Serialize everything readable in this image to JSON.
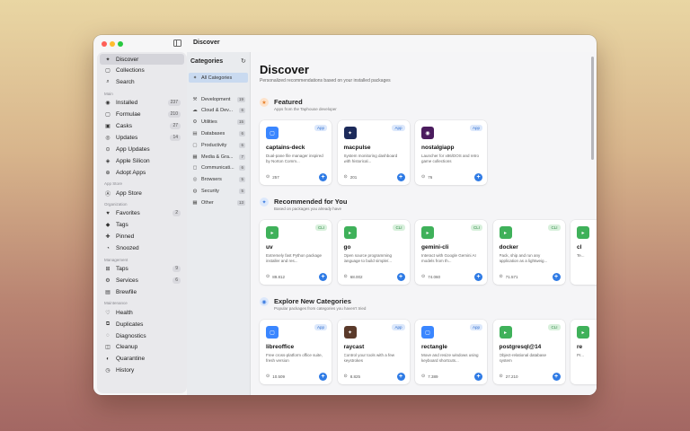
{
  "window": {
    "title": "Discover"
  },
  "sidebar": {
    "items_top": [
      {
        "icon": "sparkles-icon",
        "glyph": "✦",
        "label": "Discover",
        "active": true
      },
      {
        "icon": "collections-icon",
        "glyph": "▢",
        "label": "Collections"
      },
      {
        "icon": "search-icon",
        "glyph": "⌕",
        "label": "Search"
      }
    ],
    "section_main": "Main",
    "items_main": [
      {
        "icon": "check-circle-icon",
        "glyph": "◉",
        "label": "Installed",
        "count": "237"
      },
      {
        "icon": "box-icon",
        "glyph": "▢",
        "label": "Formulae",
        "count": "210"
      },
      {
        "icon": "cask-icon",
        "glyph": "▣",
        "label": "Casks",
        "count": "27"
      },
      {
        "icon": "arrow-up-circle-icon",
        "glyph": "◎",
        "label": "Updates",
        "count": "14"
      },
      {
        "icon": "app-updates-icon",
        "glyph": "⊙",
        "label": "App Updates"
      },
      {
        "icon": "cpu-icon",
        "glyph": "◈",
        "label": "Apple Silicon"
      },
      {
        "icon": "adopt-icon",
        "glyph": "⊕",
        "label": "Adopt Apps"
      }
    ],
    "section_appstore": "App Store",
    "items_appstore": [
      {
        "icon": "app-store-icon",
        "glyph": "Ⓐ",
        "label": "App Store"
      }
    ],
    "section_org": "Organization",
    "items_org": [
      {
        "icon": "heart-icon",
        "glyph": "♥",
        "label": "Favorites",
        "count": "2"
      },
      {
        "icon": "tag-icon",
        "glyph": "◆",
        "label": "Tags"
      },
      {
        "icon": "pin-icon",
        "glyph": "✚",
        "label": "Pinned"
      },
      {
        "icon": "snooze-icon",
        "glyph": "◔",
        "label": "Snoozed"
      }
    ],
    "section_mgmt": "Management",
    "items_mgmt": [
      {
        "icon": "taps-icon",
        "glyph": "⊞",
        "label": "Taps",
        "count": "9"
      },
      {
        "icon": "services-icon",
        "glyph": "⚙",
        "label": "Services",
        "count": "6"
      },
      {
        "icon": "brewfile-icon",
        "glyph": "▤",
        "label": "Brewfile"
      }
    ],
    "section_maint": "Maintenance",
    "items_maint": [
      {
        "icon": "health-icon",
        "glyph": "♡",
        "label": "Health"
      },
      {
        "icon": "duplicates-icon",
        "glyph": "⧉",
        "label": "Duplicates"
      },
      {
        "icon": "diagnostics-icon",
        "glyph": "◌",
        "label": "Diagnostics"
      },
      {
        "icon": "cleanup-icon",
        "glyph": "◫",
        "label": "Cleanup"
      },
      {
        "icon": "quarantine-icon",
        "glyph": "◐",
        "label": "Quarantine"
      },
      {
        "icon": "history-icon",
        "glyph": "◷",
        "label": "History"
      }
    ]
  },
  "categories": {
    "title": "Categories",
    "items": [
      {
        "icon": "sparkles-icon",
        "glyph": "✦",
        "label": "All Categories",
        "active": true
      },
      {
        "icon": "hammer-icon",
        "glyph": "⚒",
        "label": "Development",
        "count": "19"
      },
      {
        "icon": "cloud-icon",
        "glyph": "☁",
        "label": "Cloud & Dev...",
        "count": "6"
      },
      {
        "icon": "wrench-icon",
        "glyph": "⚙",
        "label": "Utilities",
        "count": "15"
      },
      {
        "icon": "database-icon",
        "glyph": "▤",
        "label": "Databases",
        "count": "6"
      },
      {
        "icon": "productivity-icon",
        "glyph": "▢",
        "label": "Productivity",
        "count": "6"
      },
      {
        "icon": "media-icon",
        "glyph": "▦",
        "label": "Media & Gra...",
        "count": "7"
      },
      {
        "icon": "communication-icon",
        "glyph": "◻",
        "label": "Communicati...",
        "count": "6"
      },
      {
        "icon": "globe-icon",
        "glyph": "◎",
        "label": "Browsers",
        "count": "5"
      },
      {
        "icon": "lock-icon",
        "glyph": "◍",
        "label": "Security",
        "count": "5"
      },
      {
        "icon": "grid-icon",
        "glyph": "▦",
        "label": "Other",
        "count": "13"
      }
    ]
  },
  "main": {
    "title": "Discover",
    "subtitle": "Personalized recommendations based on your installed packages",
    "sections": [
      {
        "icon": "star-icon",
        "glyph": "★",
        "icon_bg": "#fde3cc",
        "icon_color": "#e8812c",
        "title": "Featured",
        "subtitle": "Apps from the Taphouse developer",
        "cards": [
          {
            "name": "captains-deck",
            "desc": "Dual-pane file manager inspired by Norton Comm...",
            "downloads": "257",
            "badge": "App",
            "icon_bg": "#3a86ff",
            "glyph": "▢"
          },
          {
            "name": "macpulse",
            "desc": "System monitoring dashboard with historical...",
            "downloads": "201",
            "badge": "App",
            "icon_bg": "#1c2a5a",
            "glyph": "✦"
          },
          {
            "name": "nostalgiapp",
            "desc": "Launcher for x86/DOS and retro game collections",
            "downloads": "76",
            "badge": "App",
            "icon_bg": "#4b1c5e",
            "glyph": "◉"
          }
        ]
      },
      {
        "icon": "sparkle-icon",
        "glyph": "✦",
        "icon_bg": "#dce8fb",
        "icon_color": "#3a7be0",
        "title": "Recommended for You",
        "subtitle": "Based on packages you already have",
        "cards": [
          {
            "name": "uv",
            "desc": "Extremely fast Python package installer and res...",
            "downloads": "89.812",
            "badge": "CLI",
            "icon_bg": "#3fb15a",
            "glyph": "▸"
          },
          {
            "name": "go",
            "desc": "Open source programming language to build simple/...",
            "downloads": "68.002",
            "badge": "CLI",
            "icon_bg": "#3fb15a",
            "glyph": "▸"
          },
          {
            "name": "gemini-cli",
            "desc": "Interact with Google Gemini AI models from th...",
            "downloads": "74.060",
            "badge": "CLI",
            "icon_bg": "#3fb15a",
            "glyph": "▸"
          },
          {
            "name": "docker",
            "desc": "Pack, ship and run any application as a lightweig...",
            "downloads": "71.571",
            "badge": "CLI",
            "icon_bg": "#3fb15a",
            "glyph": "▸"
          },
          {
            "name": "cl",
            "desc": "Te...",
            "downloads": "",
            "badge": "",
            "icon_bg": "#3fb15a",
            "glyph": "▸"
          }
        ]
      },
      {
        "icon": "lightbulb-icon",
        "glyph": "◉",
        "icon_bg": "#dce8fb",
        "icon_color": "#3a7be0",
        "title": "Explore New Categories",
        "subtitle": "Popular packages from categories you haven't tried",
        "cards": [
          {
            "name": "libreoffice",
            "desc": "Free cross-platform office suite, fresh version",
            "downloads": "10.509",
            "badge": "App",
            "icon_bg": "#3a86ff",
            "glyph": "▢"
          },
          {
            "name": "raycast",
            "desc": "Control your tools with a few keystrokes",
            "downloads": "8.825",
            "badge": "App",
            "icon_bg": "#5a3a2a",
            "glyph": "✦"
          },
          {
            "name": "rectangle",
            "desc": "Move and resize windows using keyboard shortcuts...",
            "downloads": "7.389",
            "badge": "App",
            "icon_bg": "#3a86ff",
            "glyph": "▢"
          },
          {
            "name": "postgresql@14",
            "desc": "Object-relational database system",
            "downloads": "27.210",
            "badge": "CLI",
            "icon_bg": "#3fb15a",
            "glyph": "▸"
          },
          {
            "name": "re",
            "desc": "Pr...",
            "downloads": "",
            "badge": "",
            "icon_bg": "#3fb15a",
            "glyph": "▸"
          }
        ]
      }
    ]
  },
  "colors": {
    "accent": "#2f7be5",
    "cli_badge_bg": "#d8f0dc",
    "cli_badge_fg": "#2e8a45",
    "app_badge_bg": "#dce8fb",
    "app_badge_fg": "#2f6fd0"
  }
}
